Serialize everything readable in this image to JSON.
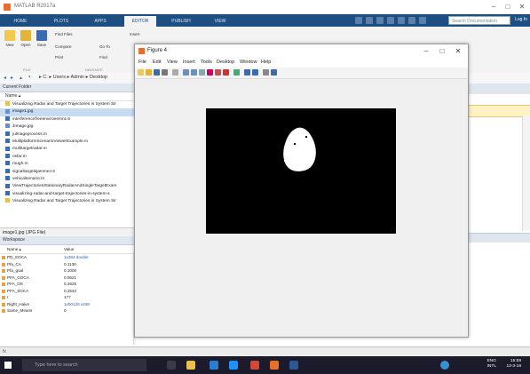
{
  "app": {
    "title": "MATLAB R2017a",
    "window_controls": [
      "–",
      "□",
      "✕"
    ]
  },
  "ribbon_tabs": [
    "HOME",
    "PLOTS",
    "APPS",
    "EDITOR",
    "PUBLISH",
    "VIEW"
  ],
  "active_tab": "EDITOR",
  "search_placeholder": "Search Documentation",
  "login_label": "Log In",
  "ribbon": {
    "new_label": "New",
    "open_label": "Open",
    "save_label": "Save",
    "find_files": "Find Files",
    "compare": "Compare",
    "go_to": "Go To",
    "print": "Print",
    "find": "Find",
    "insert": "Insert",
    "file_group": "FILE",
    "navigate_group": "NAVIGATE"
  },
  "address": {
    "path": [
      "C:",
      "Users",
      "Admin",
      "Desktop"
    ]
  },
  "current_folder": {
    "title": "Current Folder",
    "column": "Name",
    "files": [
      {
        "name": "Visualizing Radar and Target Trajectories in System Sir",
        "color": "#e8c04a",
        "selected": false
      },
      {
        "name": "image1.jpg",
        "color": "#6a8fc9",
        "selected": true
      },
      {
        "name": "interferencefreeenvironemnt.m",
        "color": "#3b6bb0",
        "selected": false
      },
      {
        "name": "JImage.jpg",
        "color": "#6a8fc9",
        "selected": false
      },
      {
        "name": "julmageprocess.m",
        "color": "#3b6bb0",
        "selected": false
      },
      {
        "name": "MultiplatformScenarioViewerExample.m",
        "color": "#3b6bb0",
        "selected": false
      },
      {
        "name": "multitargetradar.m",
        "color": "#3b6bb0",
        "selected": false
      },
      {
        "name": "osfar.m",
        "color": "#3b6bb0",
        "selected": false
      },
      {
        "name": "rough.m",
        "color": "#3b6bb0",
        "selected": false
      },
      {
        "name": "signaltargetsjammer.m",
        "color": "#3b6bb0",
        "selected": false
      },
      {
        "name": "vehicalsenario.m",
        "color": "#3b6bb0",
        "selected": false
      },
      {
        "name": "ViewTrajectoriesStationaryRadarAndSingleTargetExam",
        "color": "#3b6bb0",
        "selected": false
      },
      {
        "name": "visualizing-radar-and-target-trajectories-in-system-s",
        "color": "#3b6bb0",
        "selected": false
      },
      {
        "name": "Visualizing Radar and Target Trajectories in System Sir",
        "color": "#e8c04a",
        "selected": false
      }
    ]
  },
  "details_label": "image1.jpg (JPG File)",
  "workspace": {
    "title": "Workspace",
    "col_name": "Name",
    "col_value": "Value",
    "rows": [
      {
        "name": "PD_SOCA",
        "value": "1x384 double",
        "link": true
      },
      {
        "name": "Pfa_CA",
        "value": "0.1130",
        "link": false
      },
      {
        "name": "Pfa_goal",
        "value": "0.1000",
        "link": false
      },
      {
        "name": "PFA_GOCA",
        "value": "0.0621",
        "link": false
      },
      {
        "name": "PFA_OS",
        "value": "0.2625",
        "link": false
      },
      {
        "name": "PFA_SOCA",
        "value": "0.2542",
        "link": false
      },
      {
        "name": "r",
        "value": "177",
        "link": false
      },
      {
        "name": "Right_Halve",
        "value": "1x50126 uint8",
        "link": true
      },
      {
        "name": "Same_Means",
        "value": "0",
        "link": false
      }
    ]
  },
  "command_prompt": "fx",
  "figure": {
    "title": "Figure 4",
    "menu": [
      "File",
      "Edit",
      "View",
      "Insert",
      "Tools",
      "Desktop",
      "Window",
      "Help"
    ]
  },
  "taskbar": {
    "search_placeholder": "Type here to search",
    "lang_line1": "ENG",
    "lang_line2": "INTL",
    "time": "15:59",
    "date": "13-3-18"
  }
}
